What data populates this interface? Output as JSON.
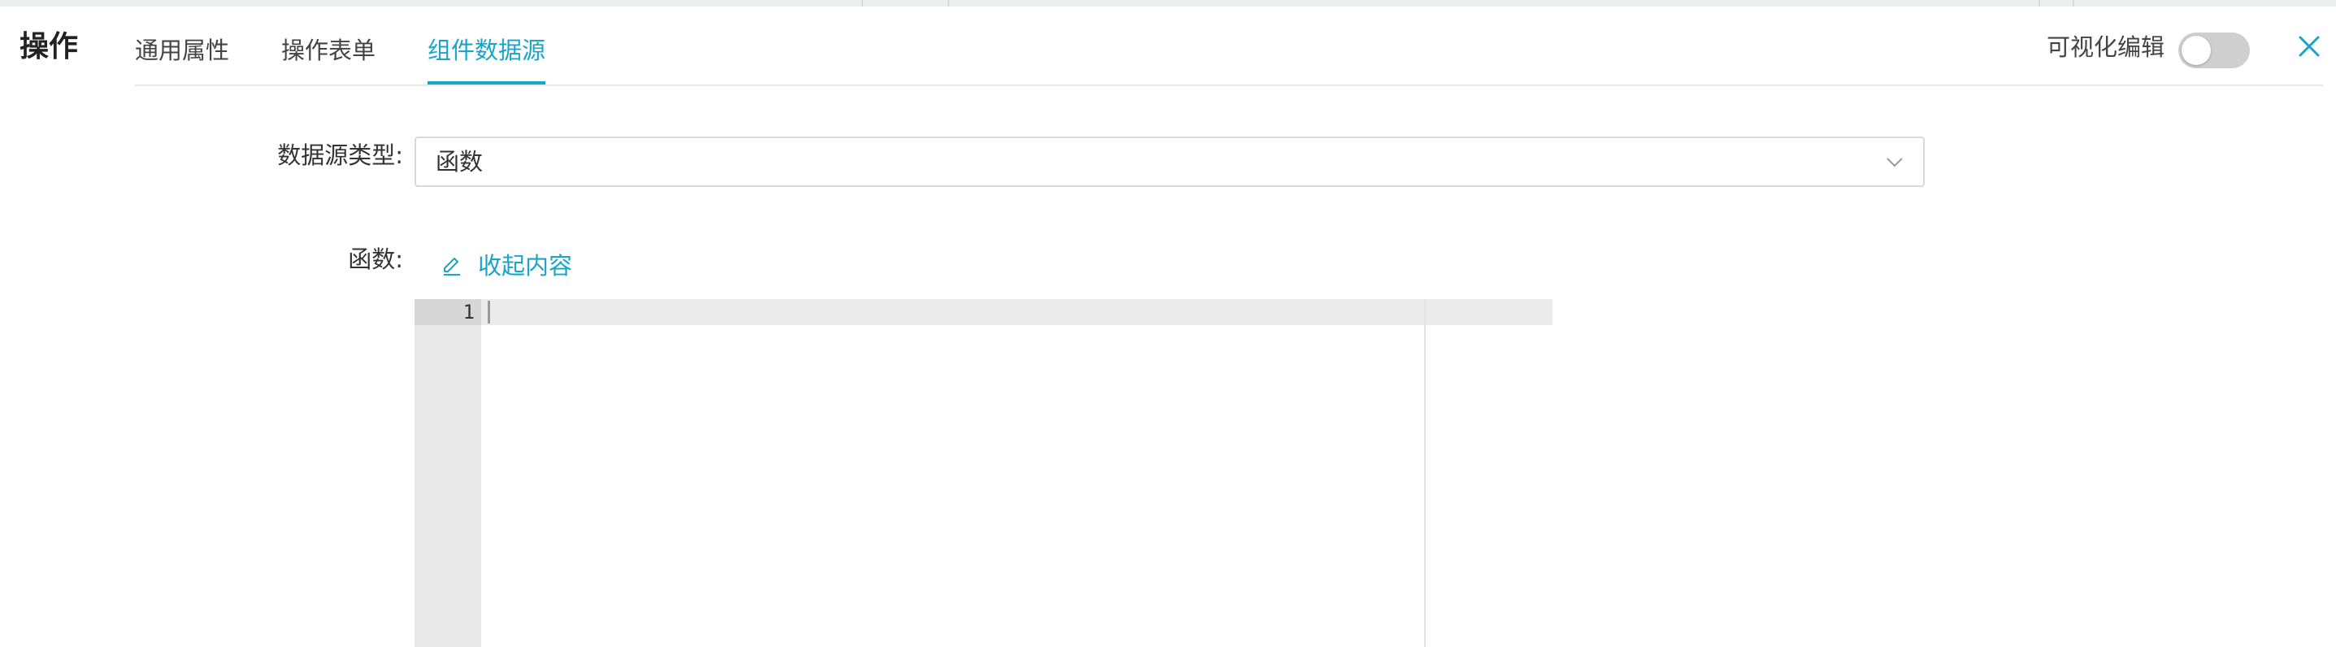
{
  "drawer": {
    "title": "操作",
    "tabs": [
      {
        "label": "通用属性",
        "active": false
      },
      {
        "label": "操作表单",
        "active": false
      },
      {
        "label": "组件数据源",
        "active": true
      }
    ],
    "visual_edit_label": "可视化编辑",
    "visual_edit_enabled": false,
    "close_icon": "close-icon"
  },
  "form": {
    "datasource_type_label": "数据源类型:",
    "datasource_type_value": "函数",
    "function_label": "函数:",
    "collapse_label": "收起内容",
    "collapse_icon": "edit-icon"
  },
  "editor": {
    "line_numbers": [
      "1"
    ],
    "content": ""
  },
  "colors": {
    "accent": "#1aa4c8",
    "toggle_off": "#cfcfcf",
    "gutter": "#e8e8e8"
  }
}
